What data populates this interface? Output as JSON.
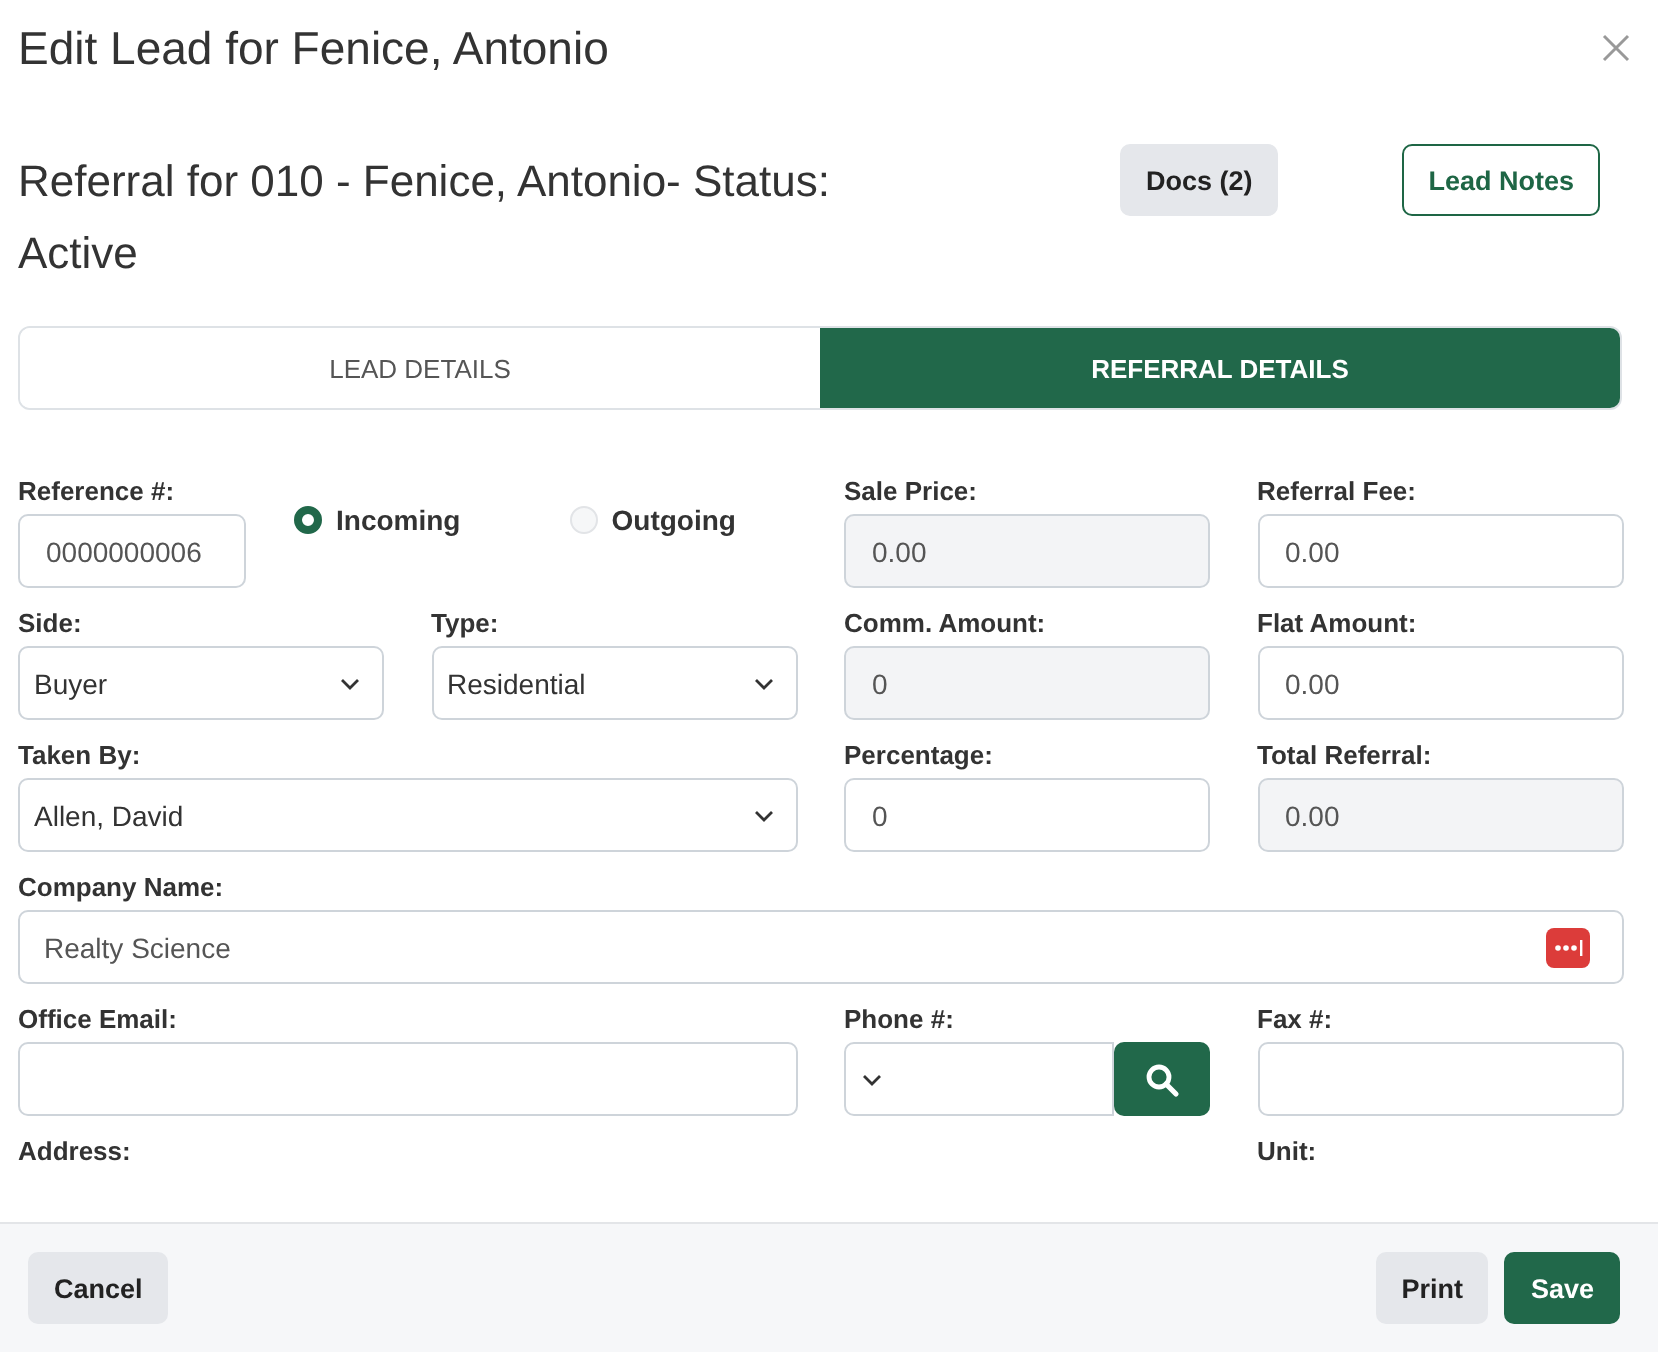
{
  "dialog": {
    "title": "Edit Lead for Fenice, Antonio"
  },
  "header": {
    "heading": "Referral for 010 - Fenice, Antonio- Status: Active",
    "buttons": [
      {
        "label": "Docs (2)",
        "kind": "secondary"
      },
      {
        "label": "Lead Notes",
        "kind": "outline"
      }
    ]
  },
  "tabs": [
    {
      "label": "LEAD DETAILS",
      "selected": false
    },
    {
      "label": "REFERRAL DETAILS",
      "selected": true
    }
  ],
  "form": {
    "reference": {
      "label": "Reference #:",
      "value": "0000000006"
    },
    "direction": [
      {
        "label": "Incoming",
        "selected": true
      },
      {
        "label": "Outgoing",
        "selected": false
      }
    ],
    "sale_price": {
      "label": "Sale Price:",
      "value": "0.00",
      "disabled": true
    },
    "referral_fee": {
      "label": "Referral Fee:",
      "value": "0.00",
      "disabled": false
    },
    "side": {
      "label": "Side:",
      "value": "Buyer"
    },
    "type": {
      "label": "Type:",
      "value": "Residential"
    },
    "comm_amount": {
      "label": "Comm. Amount:",
      "value": "0",
      "disabled": true
    },
    "flat_amount": {
      "label": "Flat Amount:",
      "value": "0.00",
      "disabled": false
    },
    "taken_by": {
      "label": "Taken By:",
      "value": "Allen, David"
    },
    "percentage": {
      "label": "Percentage:",
      "value": "0",
      "disabled": false
    },
    "total_referral": {
      "label": "Total Referral:",
      "value": "0.00",
      "disabled": true
    },
    "company_name": {
      "label": "Company Name:",
      "value": "Realty Science"
    },
    "office_email": {
      "label": "Office Email:"
    },
    "phone": {
      "label": "Phone #:"
    },
    "fax": {
      "label": "Fax #:"
    },
    "address": {
      "label": "Address:"
    },
    "unit": {
      "label": "Unit:"
    }
  },
  "footer": {
    "left": [
      {
        "label": "Cancel",
        "kind": "secondary"
      }
    ],
    "right": [
      {
        "label": "Print",
        "kind": "secondary"
      },
      {
        "label": "Save",
        "kind": "primary"
      }
    ]
  }
}
